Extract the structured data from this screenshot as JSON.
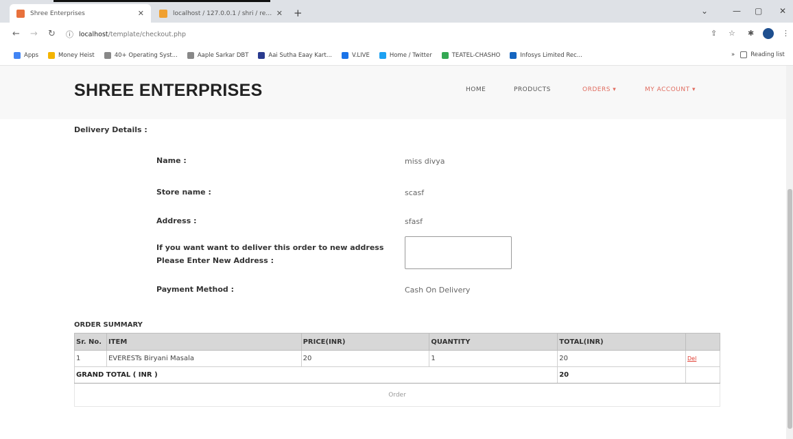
{
  "browser": {
    "tabs": [
      {
        "title": "Shree Enterprises"
      },
      {
        "title": "localhost / 127.0.0.1 / shri / regi..."
      }
    ],
    "url_host": "localhost",
    "url_path": "/template/checkout.php",
    "bookmarks": [
      {
        "label": "Apps",
        "color": "#4285f4"
      },
      {
        "label": "Money Heist",
        "color": "#f4b400"
      },
      {
        "label": "40+ Operating Syst...",
        "color": "#888888"
      },
      {
        "label": "Aaple Sarkar DBT",
        "color": "#888888"
      },
      {
        "label": "Aai Sutha Eaay Kart...",
        "color": "#2a3b8f"
      },
      {
        "label": "V.LIVE",
        "color": "#1a73e8"
      },
      {
        "label": "Home / Twitter",
        "color": "#1da1f2"
      },
      {
        "label": "TEATEL-CHASHO",
        "color": "#34a853"
      },
      {
        "label": "Infosys Limited Rec...",
        "color": "#1565c0"
      }
    ],
    "reading_list": "Reading list"
  },
  "header": {
    "brand": "SHREE ENTERPRISES",
    "nav": {
      "home": "HOME",
      "products": "PRODUCTS",
      "orders": "ORDERS ▾",
      "account": "MY ACCOUNT ▾"
    },
    "accent_color": "#e06b5e"
  },
  "delivery": {
    "title": "Delivery Details :",
    "name_label": "Name :",
    "name_value": "miss divya",
    "store_label": "Store name :",
    "store_value": "scasf",
    "address_label": "Address :",
    "address_value": "sfasf",
    "new_address_label_1": "If you want want to deliver this order to new address",
    "new_address_label_2": "Please Enter New Address :",
    "new_address_value": "",
    "payment_label": "Payment Method :",
    "payment_value": "Cash On Delivery"
  },
  "summary": {
    "title": "ORDER SUMMARY",
    "columns": {
      "sr": "Sr. No.",
      "item": "ITEM",
      "price": "PRICE(INR)",
      "qty": "QUANTITY",
      "total": "TOTAL(INR)"
    },
    "rows": [
      {
        "sr": "1",
        "item": "EVERESTs Biryani Masala",
        "price": "20",
        "qty": "1",
        "total": "20",
        "action": "Del"
      }
    ],
    "grand_total_label": "GRAND TOTAL ( INR )",
    "grand_total_value": "20",
    "order_button": "Order"
  }
}
